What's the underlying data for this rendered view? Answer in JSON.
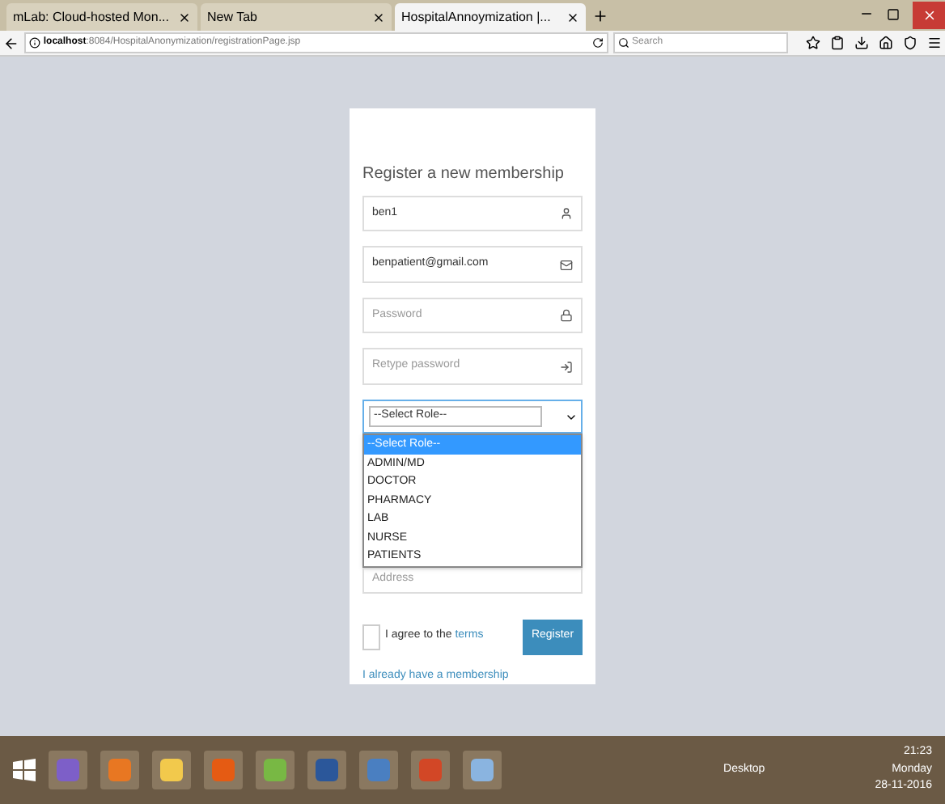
{
  "browser": {
    "tabs": [
      {
        "label": "mLab: Cloud-hosted Mon...",
        "selected": false
      },
      {
        "label": "New Tab",
        "selected": false
      },
      {
        "label": "HospitalAnnoymization |...",
        "selected": true
      }
    ],
    "url_host": "localhost",
    "url_path": ":8084/HospitalAnonymization/registrationPage.jsp",
    "search": {
      "placeholder": "Search"
    }
  },
  "form": {
    "title": "Register a new membership",
    "fields": [
      {
        "kind": "value",
        "text": "ben1"
      },
      {
        "kind": "value",
        "text": "benpatient@gmail.com"
      },
      {
        "kind": "placeholder",
        "text": "Password"
      },
      {
        "kind": "placeholder",
        "text": "Retype password"
      }
    ],
    "role_select": {
      "value": "--Select Role--",
      "expanded": true,
      "options": [
        {
          "label": "--Select Role--",
          "selected": true
        },
        {
          "label": "ADMIN/MD",
          "selected": false
        },
        {
          "label": "DOCTOR",
          "selected": false
        },
        {
          "label": "PHARMACY",
          "selected": false
        },
        {
          "label": "LAB",
          "selected": false
        },
        {
          "label": "NURSE",
          "selected": false
        },
        {
          "label": "PATIENTS",
          "selected": false
        }
      ]
    },
    "address": {
      "placeholder": "Address"
    },
    "agree": {
      "checked": false,
      "text": "I agree to the ",
      "link": "terms"
    },
    "register_button": "Register",
    "login_link": "I already have a membership"
  },
  "taskbar": {
    "tray_label": "Desktop",
    "time": "21:23",
    "day": "Monday",
    "date": "28-11-2016"
  }
}
